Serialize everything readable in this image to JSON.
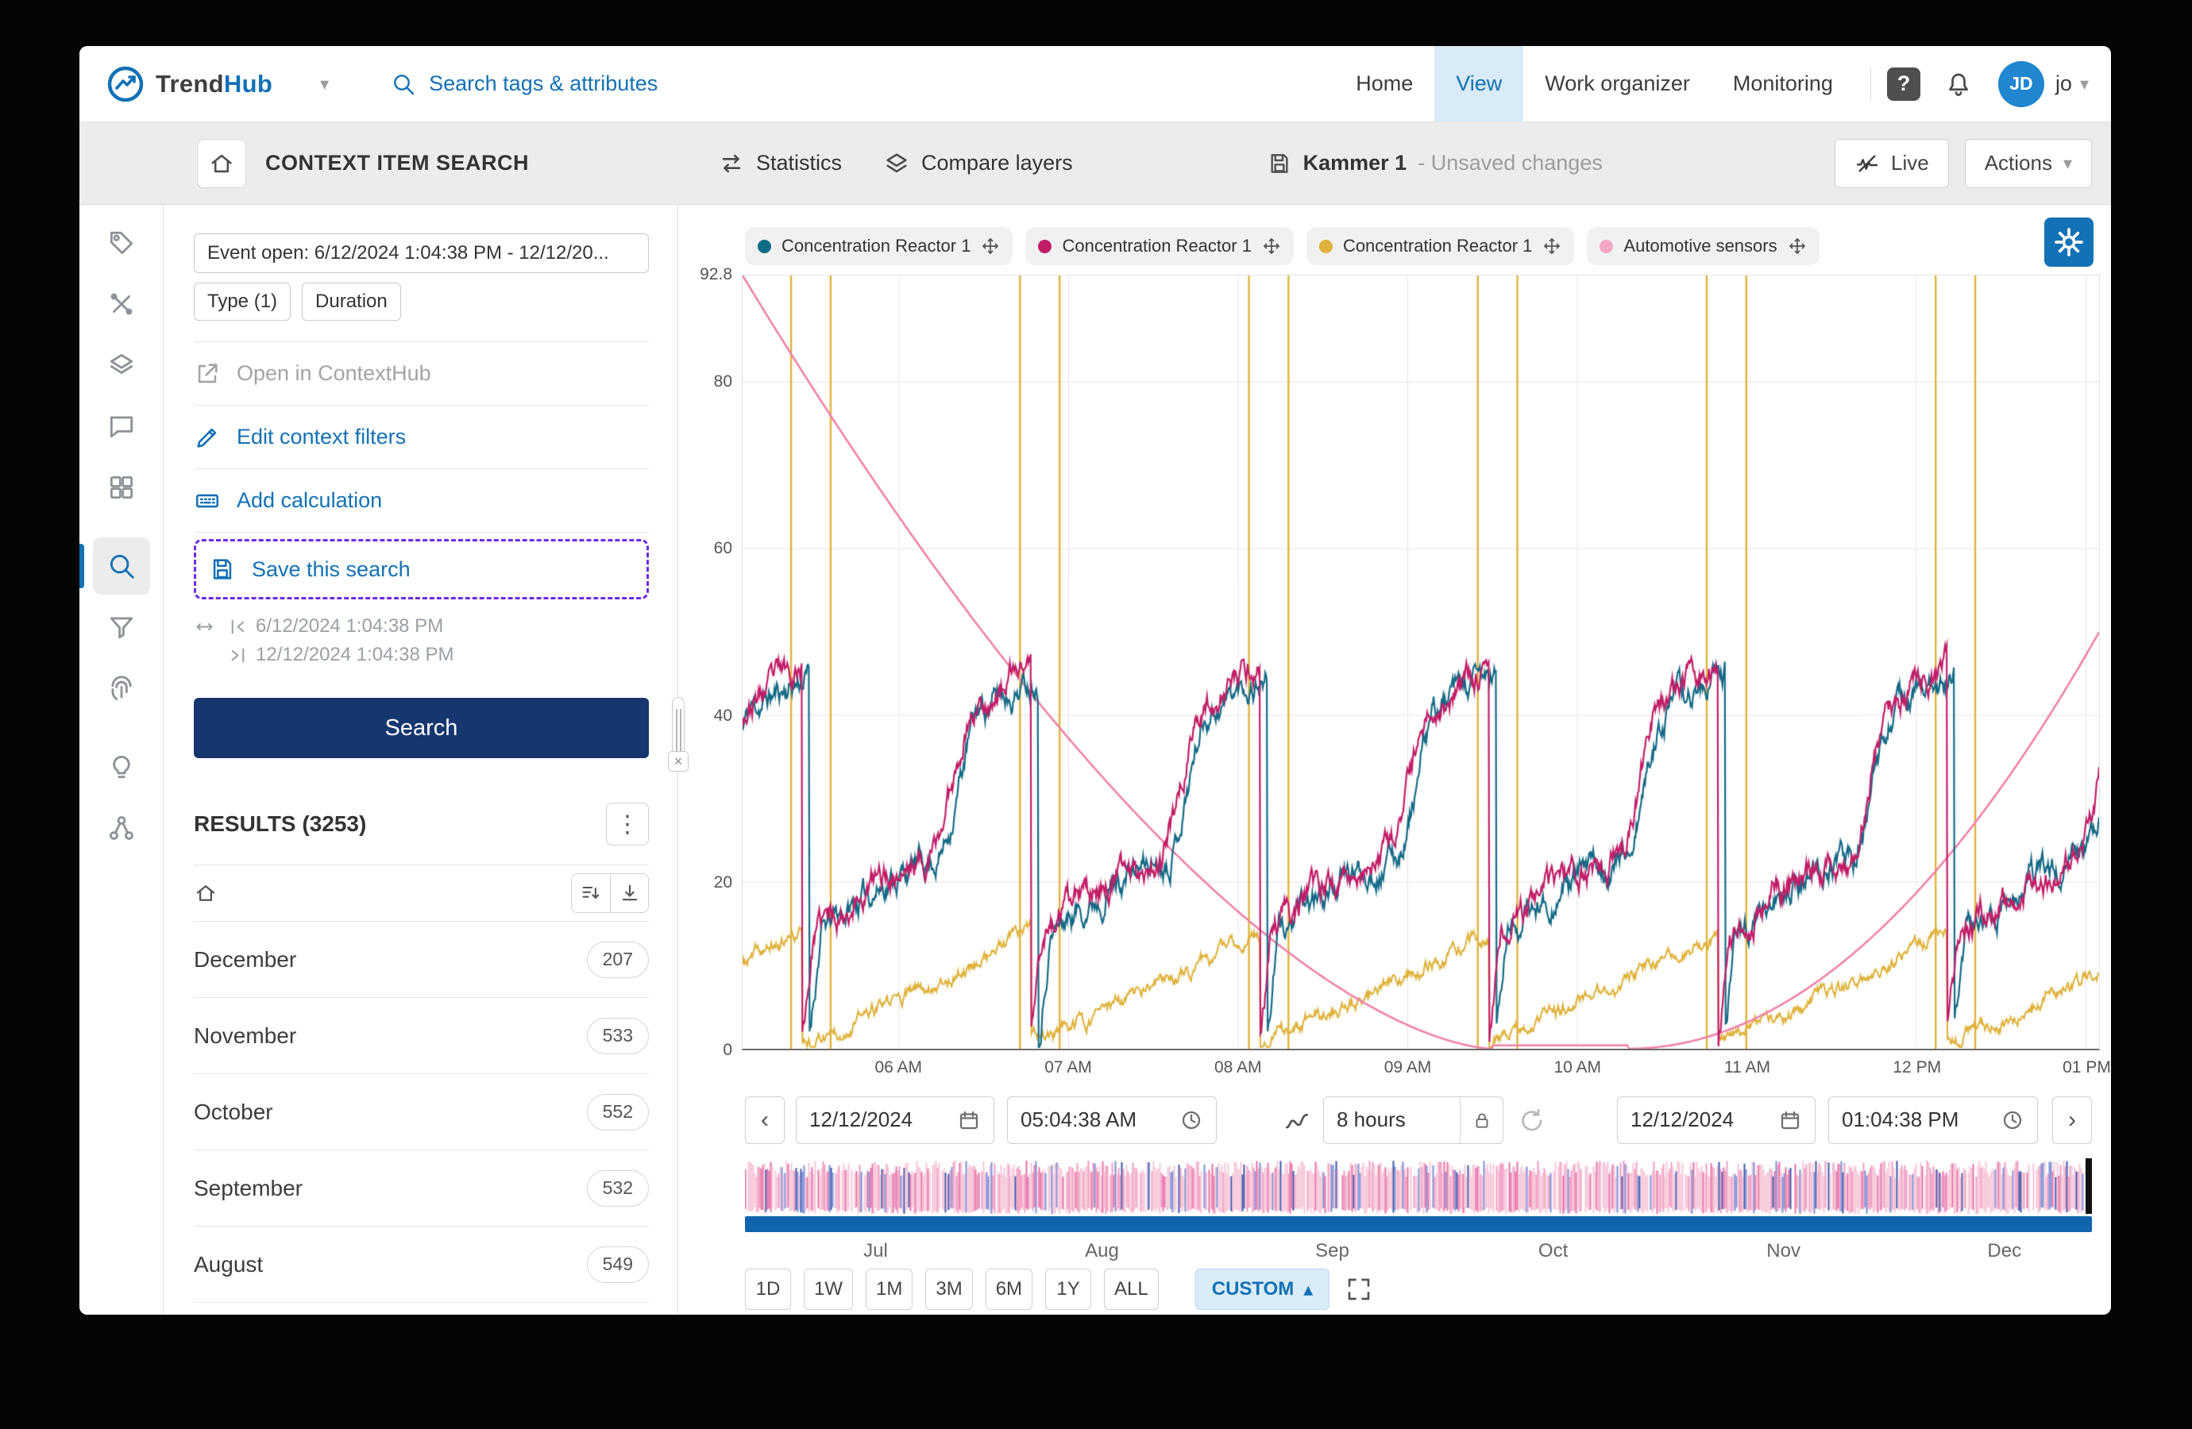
{
  "colors": {
    "accent": "#1371b5",
    "accent_bg": "#d9ebf7",
    "primary_button": "#16366f",
    "highlight_purple": "#6d2ce5",
    "overview_bar": "#1064ae"
  },
  "app": {
    "brand": {
      "name_primary": "Trend",
      "name_secondary": "Hub"
    },
    "search_placeholder": "Search tags & attributes",
    "nav": [
      {
        "label": "Home"
      },
      {
        "label": "View"
      },
      {
        "label": "Work organizer"
      },
      {
        "label": "Monitoring"
      }
    ],
    "user": {
      "initials": "JD",
      "name": "jo"
    },
    "help_glyph": "?"
  },
  "toolbar": {
    "title": "CONTEXT ITEM SEARCH",
    "statistics": "Statistics",
    "compare_layers": "Compare layers",
    "document_name": "Kammer 1",
    "document_status": "- Unsaved changes",
    "live": "Live",
    "actions": "Actions"
  },
  "sidebar": {
    "icons": [
      "tag-icon",
      "crossed-tools-icon",
      "layers-icon",
      "comment-icon",
      "dashboard-icon",
      "search-icon",
      "filter-icon",
      "fingerprint-icon",
      "lightbulb-icon",
      "hierarchy-icon"
    ],
    "active": "search-icon"
  },
  "panel": {
    "chips": {
      "event": "Event open: 6/12/2024 1:04:38 PM - 12/12/20...",
      "type": "Type (1)",
      "duration": "Duration"
    },
    "actions": {
      "open_contexthub": "Open in ContextHub",
      "edit_filters": "Edit context filters",
      "add_calculation": "Add calculation",
      "save_search": "Save this search"
    },
    "range": {
      "start": "6/12/2024 1:04:38 PM",
      "end": "12/12/2024 1:04:38 PM"
    },
    "search_button": "Search",
    "results_title": "RESULTS (3253)",
    "results": [
      {
        "label": "December",
        "count": "207"
      },
      {
        "label": "November",
        "count": "533"
      },
      {
        "label": "October",
        "count": "552"
      },
      {
        "label": "September",
        "count": "532"
      },
      {
        "label": "August",
        "count": "549"
      }
    ]
  },
  "chart": {
    "legend": [
      {
        "label": "Concentration Reactor 1",
        "color": "#0e6b86"
      },
      {
        "label": "Concentration Reactor 1",
        "color": "#c11e67"
      },
      {
        "label": "Concentration Reactor 1",
        "color": "#dfb23b"
      },
      {
        "label": "Automotive sensors",
        "color": "#f2a6c4"
      }
    ]
  },
  "controls": {
    "prev": "‹",
    "next": "›",
    "start_date": "12/12/2024",
    "start_time": "05:04:38 AM",
    "duration": "8 hours",
    "end_date": "12/12/2024",
    "end_time": "01:04:38 PM"
  },
  "overview": {
    "months": [
      "Jul",
      "Aug",
      "Sep",
      "Oct",
      "Nov",
      "Dec"
    ]
  },
  "zoom": {
    "presets": [
      "1D",
      "1W",
      "1M",
      "3M",
      "6M",
      "1Y",
      "ALL"
    ],
    "custom": "CUSTOM"
  },
  "chart_data": {
    "type": "line",
    "x_axis": {
      "start_hour": 5.0772,
      "end_hour": 13.0772,
      "start_label": "05:04:38 AM",
      "end_label": "01:04:38 PM",
      "ticks": [
        {
          "hour": 6,
          "label": "06 AM"
        },
        {
          "hour": 7,
          "label": "07 AM"
        },
        {
          "hour": 8,
          "label": "08 AM"
        },
        {
          "hour": 9,
          "label": "09 AM"
        },
        {
          "hour": 10,
          "label": "10 AM"
        },
        {
          "hour": 11,
          "label": "11 AM"
        },
        {
          "hour": 12,
          "label": "12 PM"
        },
        {
          "hour": 13,
          "label": "01 PM"
        }
      ]
    },
    "y_axis": {
      "min": 0,
      "max": 92.8,
      "ticks": [
        {
          "value": 92.8,
          "label": "92.8"
        },
        {
          "value": 80,
          "label": "80"
        },
        {
          "value": 60,
          "label": "60"
        },
        {
          "value": 40,
          "label": "40"
        },
        {
          "value": 20,
          "label": "20"
        },
        {
          "value": 0,
          "label": "0"
        }
      ]
    },
    "grid": true,
    "cycle": {
      "first_drop_hour": 5.43,
      "period_hours": 1.35
    },
    "series": [
      {
        "name": "Concentration Reactor 1",
        "color": "#156a86",
        "kind": "sawtooth",
        "lag_minutes": 2.5,
        "mid_value": 22,
        "final_value": 45,
        "seed": 11
      },
      {
        "name": "Concentration Reactor 1",
        "color": "#c11e67",
        "kind": "sawtooth",
        "lag_minutes": 0,
        "mid_value": 23,
        "final_value": 46.5,
        "seed": 23
      },
      {
        "name": "Concentration Reactor 1",
        "color": "#dfb23b",
        "kind": "ramp_with_spikes",
        "ramp_max": 14,
        "spike_offsets_min": [
          -4,
          10
        ],
        "spike_top": 92.8,
        "seed": 37
      },
      {
        "name": "Automotive sensors",
        "color": "#ef82aa",
        "kind": "u_curve",
        "left_value": 92.8,
        "zero_start_hour": 9.5,
        "zero_end_hour": 10.3,
        "right_value": 50
      }
    ]
  }
}
